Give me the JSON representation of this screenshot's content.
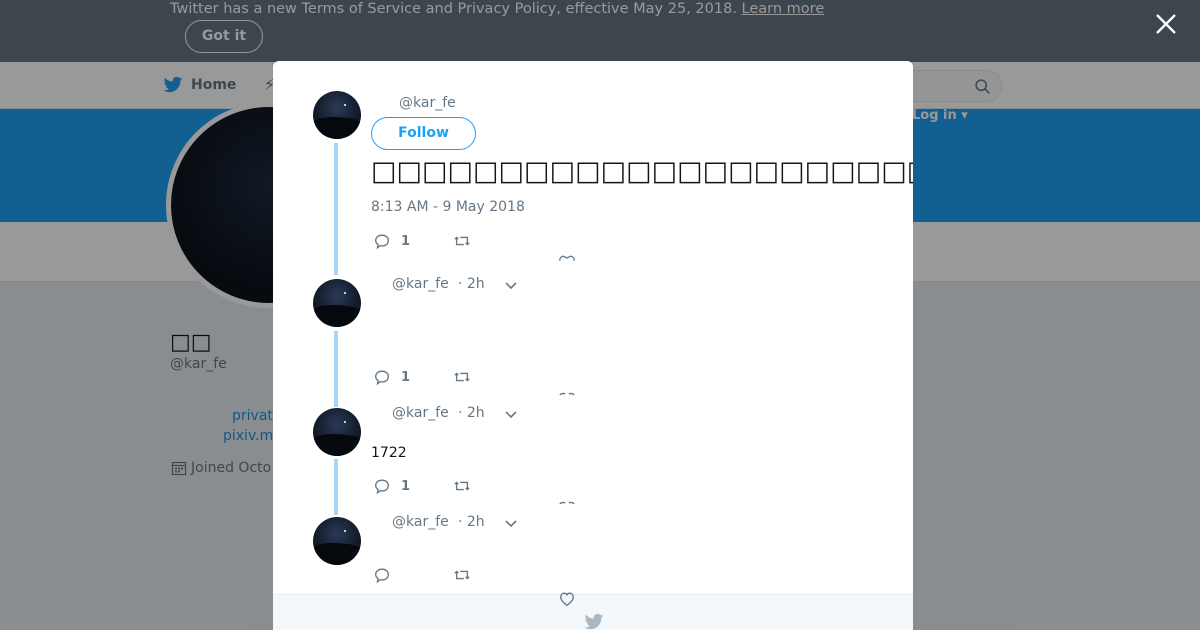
{
  "notice": {
    "text": "Twitter has a new Terms of Service and Privacy Policy, effective May 25, 2018.",
    "link": "Learn more",
    "button": "Got it"
  },
  "nav": {
    "home": "Home",
    "moments_icon": "⚡",
    "login": "Log in ▾",
    "search_icon": "search-icon"
  },
  "profile": {
    "name": "□□",
    "handle": "@kar_fe",
    "link1": "privat",
    "link2": "pixiv.m",
    "joined": "Joined Octo"
  },
  "modal": {
    "main_tweet": {
      "handle": "@kar_fe",
      "follow": "Follow",
      "text": "□□□□□□□□□□□□□□□□□□□□□□□□□□□□□□□□□□□□□□□□□□□□□□□□□",
      "time": "8:13 AM - 9 May 2018",
      "replies": "1"
    },
    "replies": [
      {
        "handle": "@kar_fe",
        "time": "· 2h",
        "text": "",
        "replies": "1"
      },
      {
        "handle": "@kar_fe",
        "time": "· 2h",
        "text": "1722",
        "replies": "1"
      },
      {
        "handle": "@kar_fe",
        "time": "· 2h",
        "text": "",
        "replies": ""
      }
    ]
  },
  "colors": {
    "accent": "#1da1f2",
    "thread_line": "#a6d8f5",
    "notice_bg": "#66757f"
  }
}
